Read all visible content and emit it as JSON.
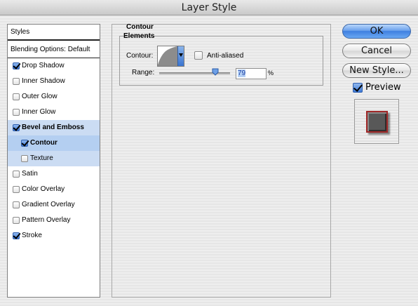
{
  "window": {
    "title": "Layer Style"
  },
  "styles_panel": {
    "header": "Styles",
    "blending_options": "Blending Options: Default",
    "items": [
      {
        "label": "Drop Shadow",
        "checked": true,
        "bold": false,
        "sub": false,
        "selected": ""
      },
      {
        "label": "Inner Shadow",
        "checked": false,
        "bold": false,
        "sub": false,
        "selected": ""
      },
      {
        "label": "Outer Glow",
        "checked": false,
        "bold": false,
        "sub": false,
        "selected": ""
      },
      {
        "label": "Inner Glow",
        "checked": false,
        "bold": false,
        "sub": false,
        "selected": ""
      },
      {
        "label": "Bevel and Emboss",
        "checked": true,
        "bold": true,
        "sub": false,
        "selected": "light"
      },
      {
        "label": "Contour",
        "checked": true,
        "bold": true,
        "sub": true,
        "selected": "strong"
      },
      {
        "label": "Texture",
        "checked": false,
        "bold": false,
        "sub": true,
        "selected": "light"
      },
      {
        "label": "Satin",
        "checked": false,
        "bold": false,
        "sub": false,
        "selected": ""
      },
      {
        "label": "Color Overlay",
        "checked": false,
        "bold": false,
        "sub": false,
        "selected": ""
      },
      {
        "label": "Gradient Overlay",
        "checked": false,
        "bold": false,
        "sub": false,
        "selected": ""
      },
      {
        "label": "Pattern Overlay",
        "checked": false,
        "bold": false,
        "sub": false,
        "selected": ""
      },
      {
        "label": "Stroke",
        "checked": true,
        "bold": false,
        "sub": false,
        "selected": ""
      }
    ]
  },
  "contour": {
    "section_title": "Contour",
    "group_title": "Elements",
    "contour_label": "Contour:",
    "anti_aliased_label": "Anti-aliased",
    "anti_aliased": false,
    "range_label": "Range:",
    "range_value": "79",
    "range_fraction": 0.79,
    "range_unit": "%"
  },
  "buttons": {
    "ok": "OK",
    "cancel": "Cancel",
    "new_style": "New Style..."
  },
  "preview": {
    "label": "Preview",
    "checked": true
  },
  "colors": {
    "selection_strong": "#b4cff1",
    "selection_light": "#cbdcf3",
    "accent_blue": "#3e7fe0",
    "stroke_red": "#a02828"
  }
}
